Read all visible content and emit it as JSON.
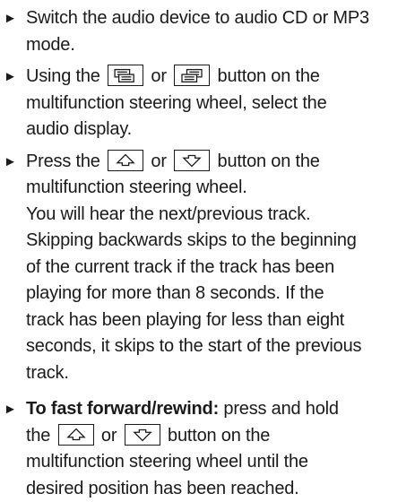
{
  "steps": [
    {
      "lines": [
        "Switch the audio device to audio CD or MP3",
        "mode."
      ]
    },
    {
      "l1_a": "Using the",
      "l1_b": "or",
      "l1_c": "button on the",
      "l2": "multifunction steering wheel, select the",
      "l3": "audio display.",
      "icons": [
        "display-prev-icon",
        "display-next-icon"
      ]
    },
    {
      "l1_a": "Press the",
      "l1_b": "or",
      "l1_c": "button on the",
      "lines": [
        "multifunction steering wheel.",
        "You will hear the next/previous track.",
        "Skipping backwards skips to the beginning",
        "of the current track if the track has been",
        "playing for more than 8 seconds. If the",
        "track has been playing for less than eight",
        "seconds, it skips to the start of the previous",
        "track."
      ],
      "icons": [
        "arrow-up-icon",
        "arrow-down-icon"
      ]
    },
    {
      "bold": "To fast forward/rewind:",
      "l1_rest": " press and hold",
      "l2_a": "the",
      "l2_b": "or",
      "l2_c": "button on the",
      "lines": [
        "multifunction steering wheel until the",
        "desired position has been reached."
      ],
      "icons": [
        "arrow-up-icon",
        "arrow-down-icon"
      ]
    }
  ],
  "bullet_glyph": "►"
}
